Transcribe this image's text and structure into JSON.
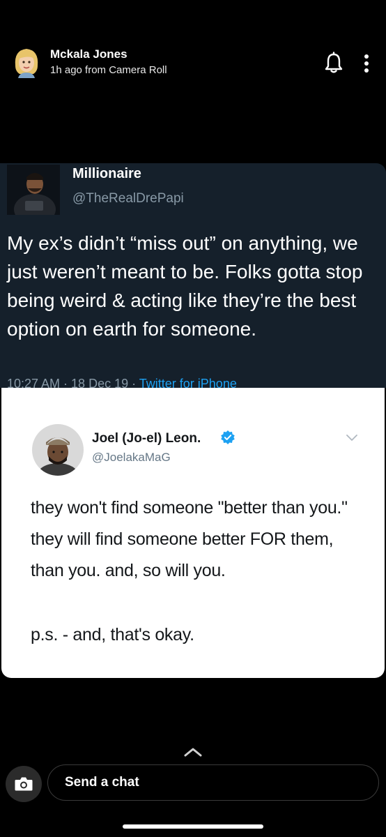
{
  "header": {
    "username": "Mckala Jones",
    "subtitle": "1h ago from Camera Roll",
    "icons": [
      "bitmoji-avatar",
      "bell-icon",
      "more-icon"
    ]
  },
  "tweet_dark": {
    "name": "Millionaire",
    "handle": "@TheRealDrePapi",
    "text": "My ex’s didn’t “miss out” on anything, we just weren’t meant to be.  Folks gotta stop being weird & acting like they’re the best option on earth for someone.",
    "meta_time": "10:27 AM · 18 Dec 19 · ",
    "meta_via": "Twitter for iPhone",
    "colors": {
      "background": "#15202b",
      "secondary_text": "#8899a6",
      "link": "#1da1f2"
    }
  },
  "tweet_light": {
    "name": "Joel (Jo-el) Leon.",
    "handle": "@JoelakaMaG",
    "text": "they won't find someone \"better than you.\" they will find someone better FOR them, than you. and, so will you.",
    "ps": "p.s. - and, that's okay.",
    "colors": {
      "verified": "#1da1f2",
      "secondary_text": "#657786"
    }
  },
  "bottom_bar": {
    "chat_placeholder": "Send a chat",
    "icons": [
      "chevron-up-icon",
      "camera-icon"
    ]
  }
}
